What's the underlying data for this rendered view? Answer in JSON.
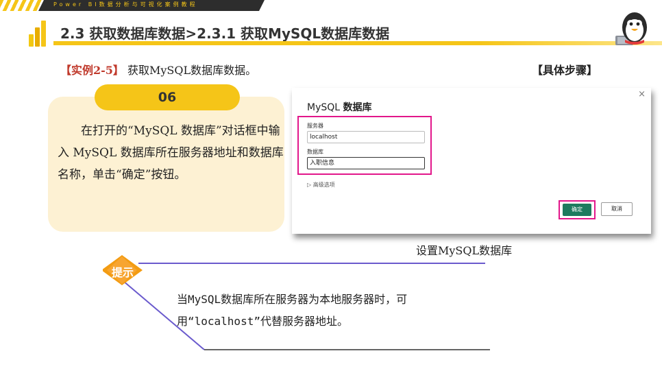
{
  "banner": {
    "text": "Power BI数据分析与可视化案例教程"
  },
  "title": "2.3  获取数据库数据>2.3.1  获取MySQL数据库数据",
  "example": {
    "tag": "【实例2-5】",
    "text": " 获取MySQL数据库数据。"
  },
  "steps_label": "【具体步骤】",
  "step": {
    "number": "06",
    "text": "在打开的“MySQL 数据库”对话框中输入 MySQL 数据库所在服务器地址和数据库名称，单击“确定”按钮。"
  },
  "dialog": {
    "close": "×",
    "title_prefix": "MySQL ",
    "title_bold": "数据库",
    "server_label": "服务器",
    "server_value": "localhost",
    "database_label": "数据库",
    "database_value": "入职信息",
    "advanced": "▷ 高级选项",
    "ok": "确定",
    "cancel": "取消"
  },
  "caption": "设置MySQL数据库",
  "tip": {
    "label": "提示",
    "text": "当MySQL数据库所在服务器为本地服务器时，可用“localhost”代替服务器地址。"
  },
  "colors": {
    "accent": "#f5c518",
    "card": "#fdf1d3",
    "highlight": "#e2168a",
    "ok_button": "#1e7b5f",
    "tip_orange": "#f39c12",
    "tip_purple": "#6a5acd"
  }
}
